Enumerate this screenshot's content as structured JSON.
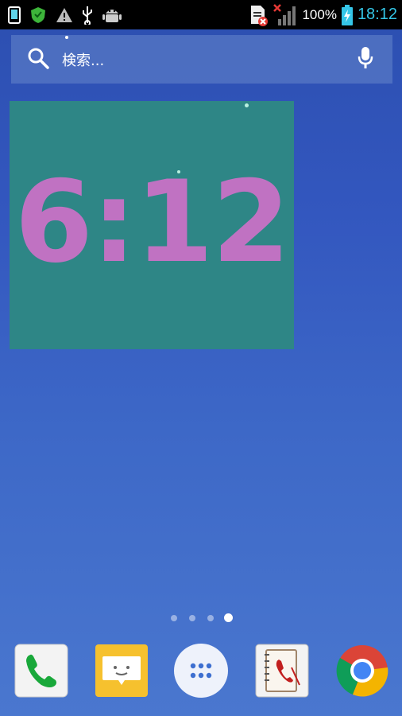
{
  "statusbar": {
    "battery_percent": "100%",
    "time": "18:12",
    "left_icons": [
      "screen-icon",
      "shield-app-icon",
      "warning-icon",
      "usb-icon",
      "android-debug-icon"
    ],
    "right_icons": [
      "sim-error-icon",
      "no-signal-icon",
      "battery-charging-icon"
    ],
    "clock_color": "#34c6e6"
  },
  "search": {
    "placeholder": "検索..."
  },
  "clock_widget": {
    "time": "6:12",
    "background": "#2e8686",
    "digit_color": "#c072c2"
  },
  "page_indicator": {
    "count": 4,
    "active_index": 3
  },
  "dock": {
    "items": [
      {
        "name": "phone-app",
        "icon": "phone-icon"
      },
      {
        "name": "messaging-app",
        "icon": "message-icon"
      },
      {
        "name": "app-drawer",
        "icon": "grid-dots-icon"
      },
      {
        "name": "contacts-app",
        "icon": "contacts-icon"
      },
      {
        "name": "chrome-app",
        "icon": "chrome-icon"
      }
    ]
  }
}
